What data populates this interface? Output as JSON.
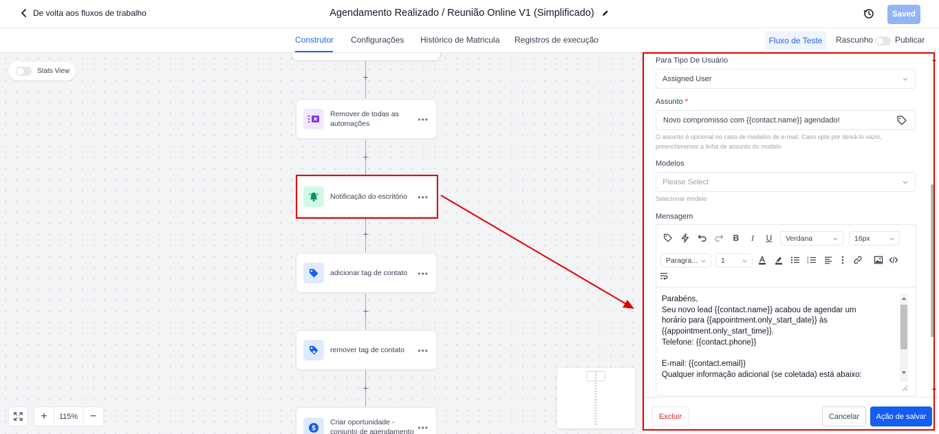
{
  "header": {
    "back_label": "De volta aos fluxos de trabalho",
    "title": "Agendamento Realizado / Reunião Online V1 (Simplificado)",
    "saved_label": "Saved"
  },
  "tabs": [
    {
      "label": "Construtor",
      "active": true
    },
    {
      "label": "Configurações",
      "active": false
    },
    {
      "label": "Histórico de Matricula",
      "active": false
    },
    {
      "label": "Registros de execução",
      "active": false
    }
  ],
  "toolbar_right": {
    "test_flow_label": "Fluxo de Teste",
    "draft_label": "Rascunho",
    "publish_label": "Publicar"
  },
  "canvas": {
    "stats_view_label": "Stats View",
    "zoom_level": "115%",
    "nodes": [
      {
        "label": "Remover de todas as automações",
        "icon": "remove-workflow-icon",
        "color": "#7c3aed"
      },
      {
        "label": "Notificação do escritório",
        "icon": "bell-icon",
        "color": "#059669"
      },
      {
        "label": "adicionar tag de contato",
        "icon": "tag-icon",
        "color": "#155eef"
      },
      {
        "label": "remover tag de contato",
        "icon": "tag-remove-icon",
        "color": "#155eef"
      },
      {
        "label": "Criar oportunidade - conjunto de agendamento",
        "icon": "dollar-icon",
        "color": "#155eef"
      }
    ]
  },
  "panel": {
    "user_type_label": "Para Tipo De Usuário",
    "user_type_value": "Assigned User",
    "subject_label": "Assunto",
    "subject_required": "*",
    "subject_value": "Novo compromisso com {{contact.name}} agendado!",
    "subject_help": "O assunto é opcional no caso de modelos de e-mail. Caso opte por deixá-lo vazio, preencheremos a linha de assunto do modelo",
    "templates_label": "Modelos",
    "templates_placeholder": "Please Select",
    "templates_help": "Selecionar modelo",
    "message_label": "Mensagem",
    "editor": {
      "font_family": "Verdana",
      "font_size": "16px",
      "paragraph": "Paragra...",
      "line_height": "1",
      "lines": [
        "Parabéns,",
        "Seu novo lead {{contact.name}} acabou de agendar um",
        "horário para {{appointment.only_start_date}} às",
        "{{appointment.only_start_time}}.",
        "Telefone: {{contact.phone}}",
        "",
        "E-mail: {{contact.email}}",
        "Qualquer informação adicional (se coletada) está abaixo:"
      ]
    },
    "delete_label": "Excluir",
    "cancel_label": "Cancelar",
    "save_label": "Ação de salvar"
  },
  "colors": {
    "accent": "#155eef",
    "highlight": "#e00000"
  }
}
